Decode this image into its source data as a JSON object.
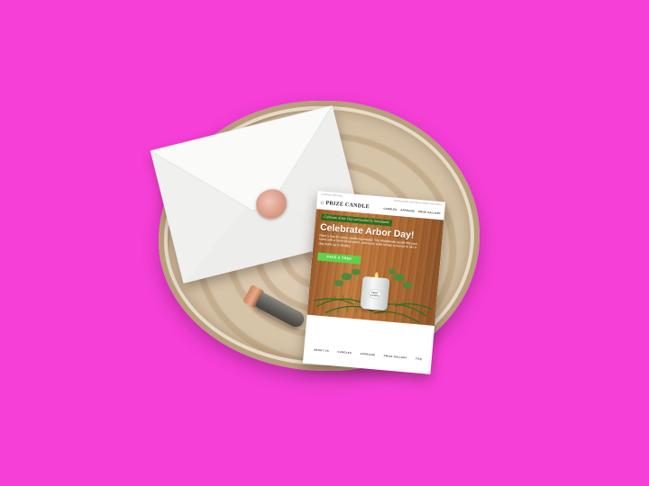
{
  "colors": {
    "background": "#f53fd6",
    "banner": "#2f6b1f",
    "cta": "#5fd14a",
    "wood": "#d6c4a9",
    "seal": "#d99a86"
  },
  "email": {
    "preheader_left": "Celebrate Arbor Day!",
    "preheader_right": "Having trouble viewing this email? View online",
    "brand_name": "PRIZE CANDLE",
    "brand_icon": "diamond-icon",
    "nav": [
      "CANDLES",
      "APPRAISE",
      "PRIZE GALLERY"
    ],
    "banner": "Celebrate Arbor Day surrounded by Woodlands",
    "headline": "Celebrate Arbor Day!",
    "body": "Plant a tree for every candle purchased. The Woodlands candle fills your home with a fresh forest scent, and every order brings a chance to win a ring worth up to $5,000.",
    "cta_label": "SAVE A TREE",
    "jar_label": "PRIZE CANDLE",
    "footer": [
      "ABOUT US",
      "CANDLES",
      "APPRAISE",
      "PRIZE GALLERY",
      "FAQ"
    ]
  }
}
